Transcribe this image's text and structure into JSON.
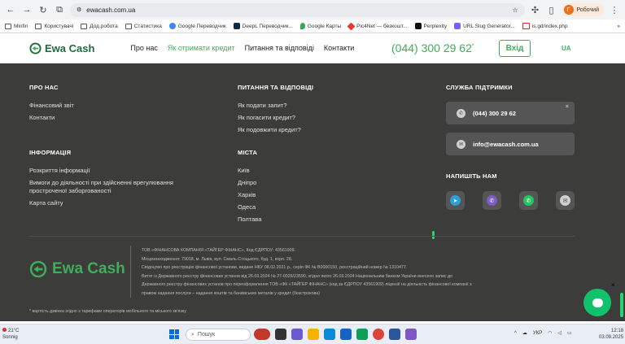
{
  "browser": {
    "url": "ewacash.com.ua",
    "profile_initial": "Г",
    "profile_label": "Робочий",
    "bookmarks": [
      {
        "label": "Minfin",
        "icon": "folder-icon"
      },
      {
        "label": "Користувачі",
        "icon": "folder-icon"
      },
      {
        "label": "Дод.робота",
        "icon": "folder-icon"
      },
      {
        "label": "Статистика",
        "icon": "folder-icon"
      },
      {
        "label": "Google Переводчик",
        "icon": "google-translate-icon"
      },
      {
        "label": "DeepL Переводчик...",
        "icon": "deepl-icon"
      },
      {
        "label": "Google Карты",
        "icon": "maps-pin-icon"
      },
      {
        "label": "Pic4Net — безкошт...",
        "icon": "pic4net-icon"
      },
      {
        "label": "Perplexity",
        "icon": "perplexity-icon"
      },
      {
        "label": "URL Slug Generator...",
        "icon": "slug-icon"
      },
      {
        "label": "is.gd/index.php",
        "icon": "isgd-icon"
      }
    ],
    "more_bookmarks": "»"
  },
  "header": {
    "logo_text": "Ewa Cash",
    "nav": [
      {
        "label": "Про нас",
        "active": false
      },
      {
        "label": "Як отримати кредит",
        "active": true
      },
      {
        "label": "Питання та відповіді",
        "active": false
      },
      {
        "label": "Контакти",
        "active": false
      }
    ],
    "phone": "(044) 300 29 62",
    "phone_mark": "*",
    "login_label": "Вхід",
    "lang": "UA"
  },
  "footer": {
    "about": {
      "title": "ПРО НАС",
      "links": [
        "Фінансовий звіт",
        "Контакти"
      ]
    },
    "faq": {
      "title": "ПИТАННЯ ТА ВІДПОВІДІ",
      "links": [
        "Як подати запит?",
        "Як погасити кредит?",
        "Як подовжити кредит?"
      ]
    },
    "support": {
      "title": "СЛУЖБА ПІДТРИМКИ",
      "phone": "(044) 300 29 62",
      "email": "info@ewacash.com.ua",
      "close": "×"
    },
    "info": {
      "title": "ІНФОРМАЦІЯ",
      "links": [
        "Розкриття інформації",
        "Вимоги до діяльності при здійсненні врегулювання простроченої заборгованості",
        "Карта сайту"
      ]
    },
    "cities": {
      "title": "МІСТА",
      "links": [
        "Київ",
        "Дніпро",
        "Харків",
        "Одеса",
        "Полтава"
      ]
    },
    "write_us": {
      "title": "НАПИШІТЬ НАМ",
      "channels": [
        {
          "name": "telegram",
          "icon": "telegram-icon",
          "color": "#2a9fd8"
        },
        {
          "name": "viber",
          "icon": "viber-icon",
          "color": "#7d5cc5"
        },
        {
          "name": "whatsapp",
          "icon": "whatsapp-icon",
          "color": "#25c562"
        },
        {
          "name": "email",
          "icon": "mail-icon",
          "color": "#cfcfcf"
        }
      ]
    },
    "logo_text": "Ewa Cash",
    "legal_lines": [
      "ТОВ «ФІНАНСОВА КОМПАНІЯ «ТАЙГЕР ФІНАНС», Код ЄДРПОУ: 43561909.",
      "Місцезнаходження: 79018, м. Львів, вул. Смаль-Стоцького, буд. 1, корп. 28.",
      "Свідоцтво про реєстрацію фінансової установи, видане НБУ 08.02.2021 р., серія ФК № В0000150, реєстраційний номер № 1310477.",
      "Витяг із Державного реєстру фінансових установ від 26.03.2024 № 27-0026/23590, згідно якого 26.03.2024 Національним банком України внесено запис до",
      "Державного реєстру фінансових установ про переоформлення ТОВ «ФК «ТАЙГЕР ФІНАНС» (код за ЄДРПОУ 43561909) ліцензії на діяльність фінансової компанії з",
      "правом надання послуги – надання коштів та банківських металів у кредит (безстрокова)"
    ],
    "footnote": "* вартість дзвінка згідно з тарифами операторів мобільного та міського зв'язку"
  },
  "chat": {
    "close": "×"
  },
  "taskbar": {
    "weather_temp": "21°C",
    "weather_desc": "Sonnig",
    "search_placeholder": "Пошук",
    "lang": "УКР",
    "time": "12:18",
    "date": "03.09.2025"
  },
  "colors": {
    "brand_green": "#3fae5a",
    "footer_bg": "#3c3c3b",
    "card_bg": "#555555",
    "chat_green": "#11c26d"
  }
}
